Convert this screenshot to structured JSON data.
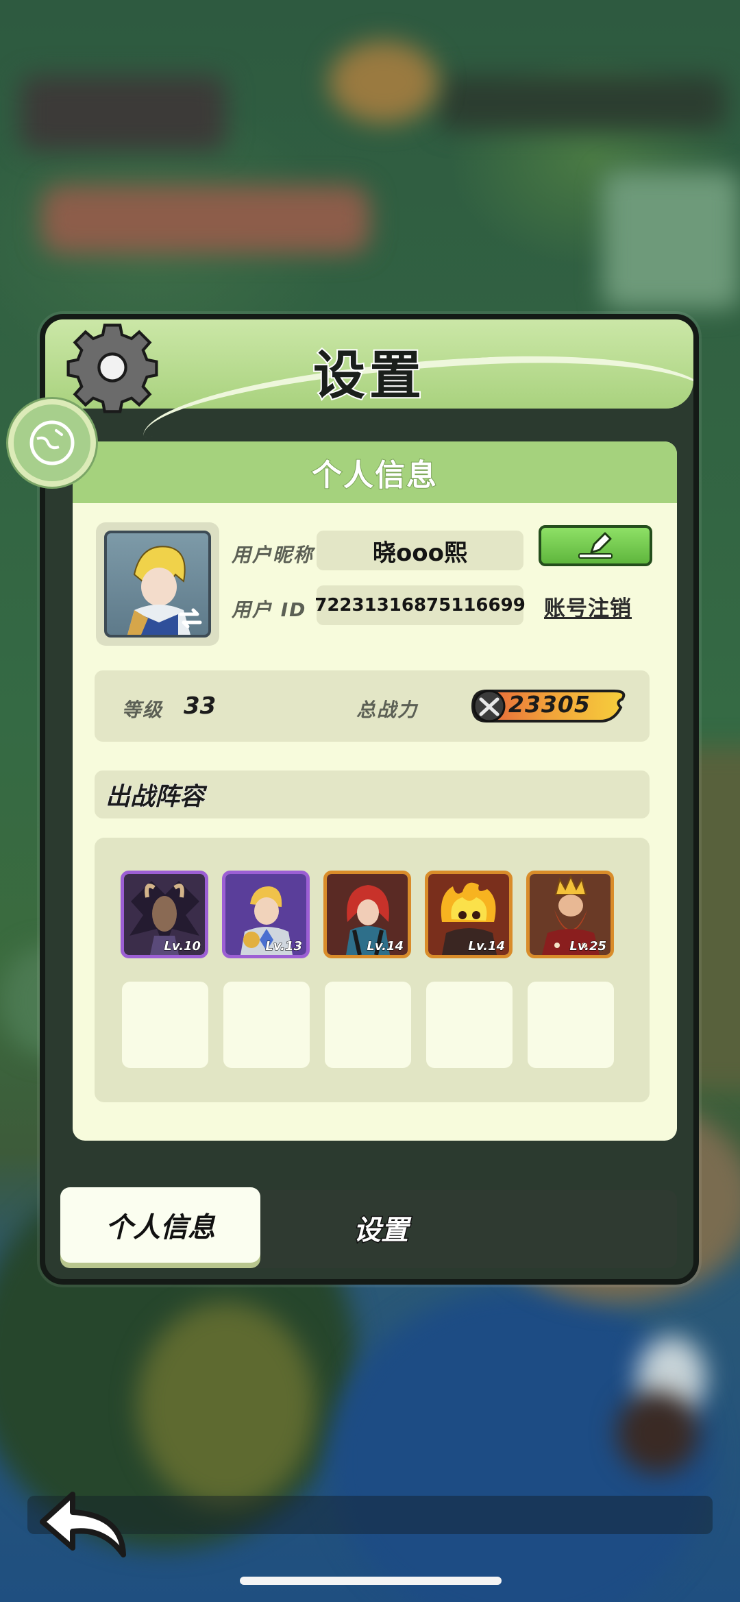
{
  "modal": {
    "title": "设置"
  },
  "profile": {
    "section_title": "个人信息",
    "nickname_label": "用户昵称",
    "nickname": "晓ooo熙",
    "id_label": "用户  ID",
    "user_id": "72231316875116699",
    "delete_account": "账号注销",
    "level_label": "等级",
    "level": "33",
    "power_label": "总战力",
    "power": "23305"
  },
  "lineup": {
    "title": "出战阵容",
    "heroes": [
      {
        "level": "Lv.10",
        "rarity": "epic",
        "color": "#3b2d4a"
      },
      {
        "level": "Lv.13",
        "rarity": "epic",
        "color": "#5a3e9a"
      },
      {
        "level": "Lv.14",
        "rarity": "legend",
        "color": "#5a2a24"
      },
      {
        "level": "Lv.14",
        "rarity": "legend",
        "color": "#7a2f1c"
      },
      {
        "level": "Lv.25",
        "rarity": "legend",
        "color": "#6a3a26"
      }
    ]
  },
  "tabs": {
    "active": "个人信息",
    "inactive": "设置"
  },
  "colors": {
    "accent_green": "#a5d27d",
    "panel_bg": "#f7fbdc",
    "epic_border": "#9c5fd4",
    "legend_border": "#d98c2a"
  }
}
